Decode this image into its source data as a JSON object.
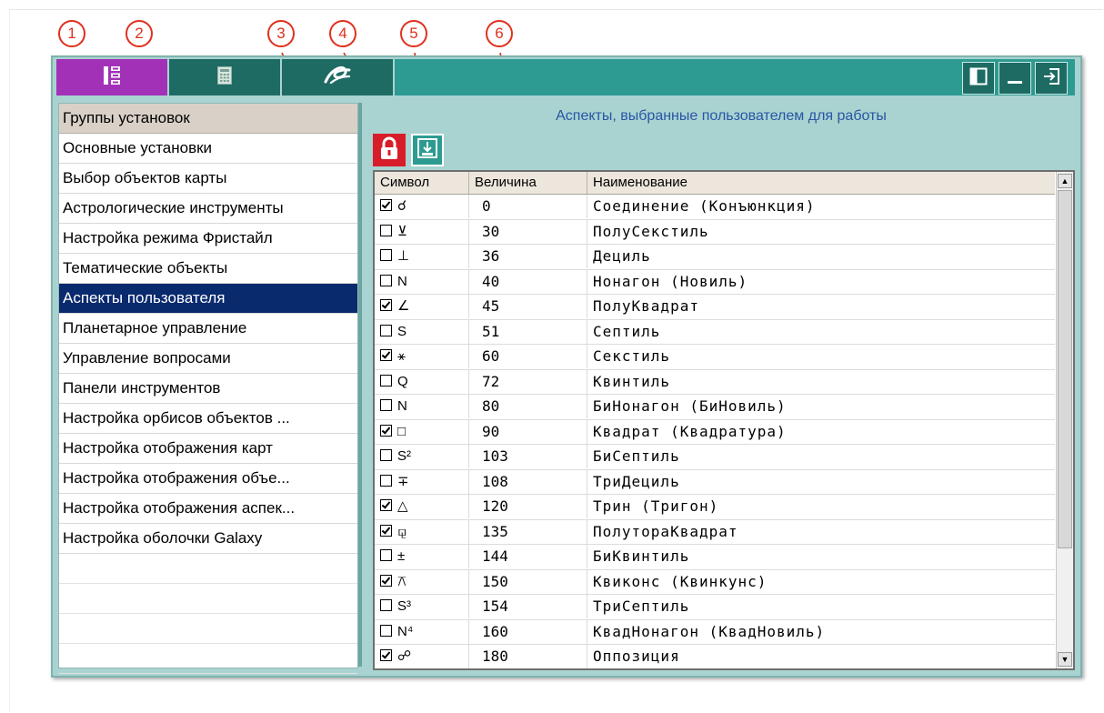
{
  "callouts": [
    "1",
    "2",
    "3",
    "4",
    "5",
    "6"
  ],
  "left_panel": {
    "header": "Группы установок",
    "items": [
      "Основные установки",
      "Выбор объектов карты",
      "Астрологические инструменты",
      "Настройка режима Фристайл",
      "Тематические объекты",
      "Аспекты пользователя",
      "Планетарное управление",
      "Управление вопросами",
      "Панели инструментов",
      "Настройка орбисов объектов ...",
      "Настройка отображения карт",
      "Настройка отображения объе...",
      "Настройка отображения аспек...",
      "Настройка оболочки Galaxy"
    ],
    "selected_index": 5
  },
  "right_panel": {
    "title": "Аспекты, выбранные пользователем для работы"
  },
  "table": {
    "headers": [
      "Символ",
      "Величина",
      "Наименование"
    ],
    "rows": [
      {
        "checked": true,
        "symbol": "☌",
        "value": "0",
        "name": "Соединение (Конъюнкция)"
      },
      {
        "checked": false,
        "symbol": "⊻",
        "value": "30",
        "name": "ПолуСекстиль"
      },
      {
        "checked": false,
        "symbol": "⊥",
        "value": "36",
        "name": "Дециль"
      },
      {
        "checked": false,
        "symbol": "N",
        "value": "40",
        "name": "Нонагон (Новиль)"
      },
      {
        "checked": true,
        "symbol": "∠",
        "value": "45",
        "name": "ПолуКвадрат"
      },
      {
        "checked": false,
        "symbol": "S",
        "value": "51",
        "name": "Септиль"
      },
      {
        "checked": true,
        "symbol": "⚹",
        "value": "60",
        "name": "Секстиль"
      },
      {
        "checked": false,
        "symbol": "Q",
        "value": "72",
        "name": "Квинтиль"
      },
      {
        "checked": false,
        "symbol": "N",
        "value": "80",
        "name": "БиНонагон (БиНовиль)"
      },
      {
        "checked": true,
        "symbol": "□",
        "value": "90",
        "name": "Квадрат (Квадратура)"
      },
      {
        "checked": false,
        "symbol": "S²",
        "value": "103",
        "name": "БиСептиль"
      },
      {
        "checked": false,
        "symbol": "∓",
        "value": "108",
        "name": "ТриДециль"
      },
      {
        "checked": true,
        "symbol": "△",
        "value": "120",
        "name": "Трин (Тригон)"
      },
      {
        "checked": true,
        "symbol": "⚼",
        "value": "135",
        "name": "ПолутораКвадрат"
      },
      {
        "checked": false,
        "symbol": "±",
        "value": "144",
        "name": "БиКвинтиль"
      },
      {
        "checked": true,
        "symbol": "⚻",
        "value": "150",
        "name": "Квиконс (Квинкунс)"
      },
      {
        "checked": false,
        "symbol": "S³",
        "value": "154",
        "name": "ТриСептиль"
      },
      {
        "checked": false,
        "symbol": "N⁴",
        "value": "160",
        "name": "КвадНонагон (КвадНовиль)"
      },
      {
        "checked": true,
        "symbol": "☍",
        "value": "180",
        "name": "Оппозиция"
      }
    ]
  },
  "colors": {
    "accent_purple": "#a231b8",
    "teal_dark": "#1e6b64",
    "teal": "#2d9b92",
    "panel_bg": "#a9d3d0",
    "selection": "#0a2a6e",
    "callout": "#e0301e",
    "lock_red": "#d81d2a"
  },
  "icons": {
    "toolbar_tab_1": "settings-grid-icon",
    "toolbar_tab_2": "calculator-icon",
    "toolbar_tab_3": "galaxy-logo-icon",
    "window_restore": "panel-toggle-icon",
    "window_minimize": "minimize-icon",
    "window_exit": "exit-icon",
    "lock": "lock-icon",
    "save": "save-icon"
  }
}
